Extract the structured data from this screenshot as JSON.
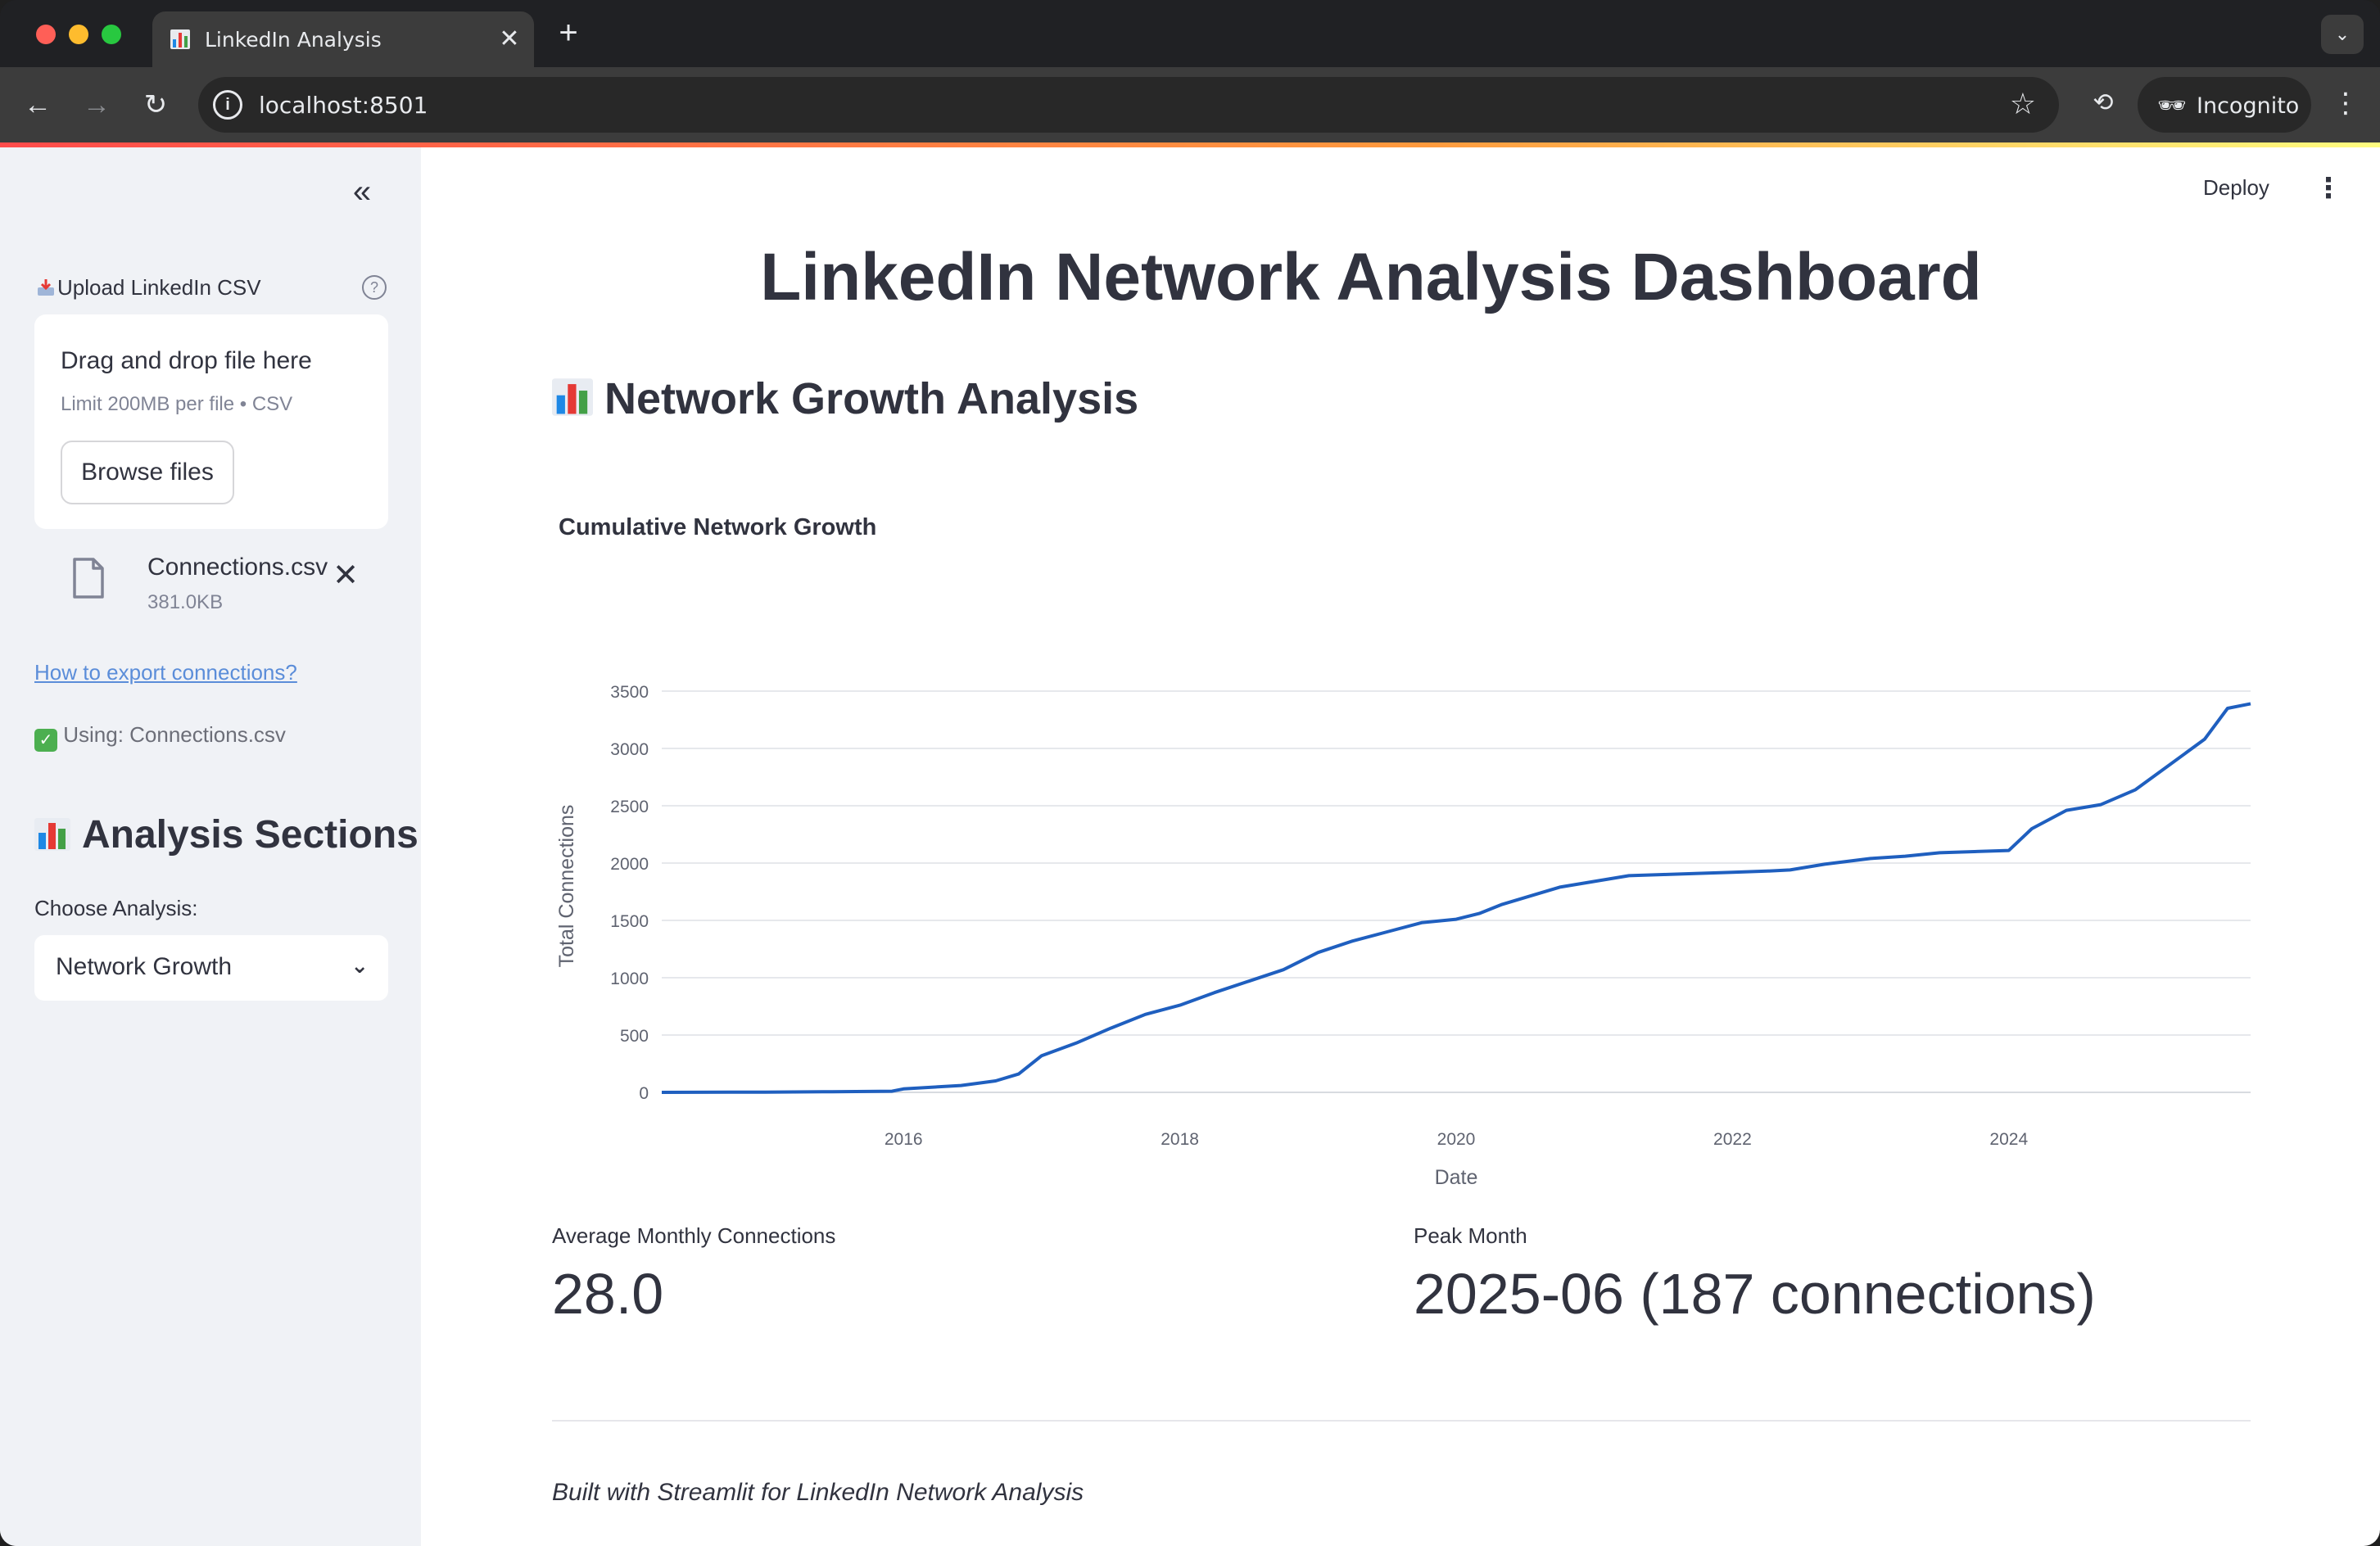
{
  "browser": {
    "tab_title": "LinkedIn Analysis",
    "url": "localhost:8501",
    "profile_label": "Incognito"
  },
  "sidebar": {
    "upload_label": "Upload LinkedIn CSV",
    "dropzone_title": "Drag and drop file here",
    "dropzone_limit": "Limit 200MB per file • CSV",
    "browse_label": "Browse files",
    "file_name": "Connections.csv",
    "file_size": "381.0KB",
    "export_link": "How to export connections?",
    "using_text": "Using: Connections.csv",
    "analysis_heading": "Analysis Sections",
    "choose_label": "Choose Analysis:",
    "selected_analysis": "Network Growth"
  },
  "header": {
    "deploy_label": "Deploy"
  },
  "main": {
    "page_title": "LinkedIn Network Analysis Dashboard",
    "section_heading": "Network Growth Analysis",
    "metrics": [
      {
        "label": "Average Monthly Connections",
        "value": "28.0"
      },
      {
        "label": "Peak Month",
        "value": "2025-06 (187 connections)"
      }
    ],
    "footer": "Built with Streamlit for LinkedIn Network Analysis"
  },
  "colors": {
    "accent_line": "#1f5fbf",
    "text": "#31333f",
    "sidebar_bg": "#f0f2f6",
    "link": "#5b8dd9"
  },
  "chart_data": {
    "type": "line",
    "title": "Cumulative Network Growth",
    "xlabel": "Date",
    "ylabel": "Total Connections",
    "xlim": [
      "2014-04",
      "2025-10"
    ],
    "ylim": [
      0,
      3600
    ],
    "x_ticks": [
      "2016",
      "2018",
      "2020",
      "2022",
      "2024"
    ],
    "y_ticks": [
      "0",
      "500",
      "1000",
      "1500",
      "2000",
      "2500",
      "3000",
      "3500"
    ],
    "grid": true,
    "series": [
      {
        "x": [
          "2014-04",
          "2015-01",
          "2015-06",
          "2015-12",
          "2016-01",
          "2016-06",
          "2016-09",
          "2016-11",
          "2017-01",
          "2017-04",
          "2017-07",
          "2017-10",
          "2018-01",
          "2018-04",
          "2018-07",
          "2018-10",
          "2019-01",
          "2019-04",
          "2019-07",
          "2019-10",
          "2020-01",
          "2020-03",
          "2020-05",
          "2020-08",
          "2020-10",
          "2021-01",
          "2021-04",
          "2021-07",
          "2021-10",
          "2022-01",
          "2022-04",
          "2022-06",
          "2022-09",
          "2023-01",
          "2023-04",
          "2023-07",
          "2023-10",
          "2024-01",
          "2024-03",
          "2024-06",
          "2024-09",
          "2024-12",
          "2025-03",
          "2025-06",
          "2025-08",
          "2025-10"
        ],
        "y": [
          0,
          2,
          5,
          10,
          30,
          60,
          100,
          160,
          320,
          430,
          560,
          680,
          760,
          870,
          970,
          1070,
          1220,
          1320,
          1400,
          1480,
          1510,
          1560,
          1640,
          1730,
          1790,
          1840,
          1890,
          1900,
          1910,
          1920,
          1930,
          1940,
          1990,
          2040,
          2060,
          2090,
          2100,
          2110,
          2300,
          2460,
          2510,
          2640,
          2860,
          3080,
          3350,
          3390
        ]
      }
    ]
  }
}
